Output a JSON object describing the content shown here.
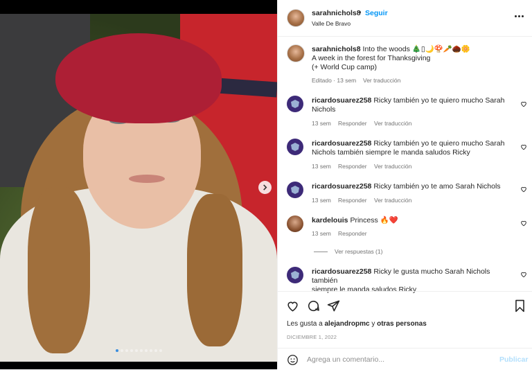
{
  "post": {
    "username": "sarahnichols8",
    "separator": "•",
    "follow_label": "Seguir",
    "location": "Valle De Bravo",
    "caption_line1": "Into the woods 🎄▯🌙🍄🥕🌰🌼",
    "caption_line2": "A week in the forest for Thanksgiving",
    "caption_line3": "(+ World Cup camp)",
    "caption_meta_edited": "Editado · 13 sem",
    "caption_meta_translate": "Ver traducción",
    "likes_prefix": "Les gusta a",
    "likes_user": "alejandropmc",
    "likes_suffix": "y",
    "likes_others": "otras personas",
    "date": "DICIEMBRE 1, 2022",
    "add_comment_placeholder": "Agrega un comentario...",
    "publish_label": "Publicar",
    "media_dots": 10,
    "media_active_dot": 0
  },
  "comments": [
    {
      "user": "ricardosuarez258",
      "line1": "Ricky también yo te quiero mucho Sarah",
      "line2": "Nichols",
      "age": "13 sem",
      "reply": "Responder",
      "translate": "Ver traducción"
    },
    {
      "user": "ricardosuarez258",
      "line1": "Ricky también yo te quiero mucho Sarah",
      "line2": "Nichols también siempre le manda saludos Ricky",
      "age": "13 sem",
      "reply": "Responder",
      "translate": "Ver traducción"
    },
    {
      "user": "ricardosuarez258",
      "line1": "Ricky también yo te amo Sarah Nichols",
      "line2": "",
      "age": "13 sem",
      "reply": "Responder",
      "translate": "Ver traducción"
    },
    {
      "user": "kardelouis",
      "line1": "Princess 🔥❤️",
      "line2": "",
      "age": "13 sem",
      "reply": "Responder",
      "translate": "",
      "view_replies": "Ver respuestas (1)"
    },
    {
      "user": "ricardosuarez258",
      "line1": "Ricky le gusta mucho Sarah Nichols también",
      "line2": "siempre le manda saludos Ricky",
      "age": "",
      "reply": "",
      "translate": ""
    }
  ],
  "colors": {
    "accent": "#0095f6",
    "beret": "#ad1f35",
    "blanket": "#c7252c",
    "dot_active": "#3a8dde"
  },
  "icons": [
    "chevron-right-icon",
    "more-icon",
    "heart-icon",
    "comment-icon",
    "share-icon",
    "bookmark-icon",
    "emoji-icon"
  ]
}
